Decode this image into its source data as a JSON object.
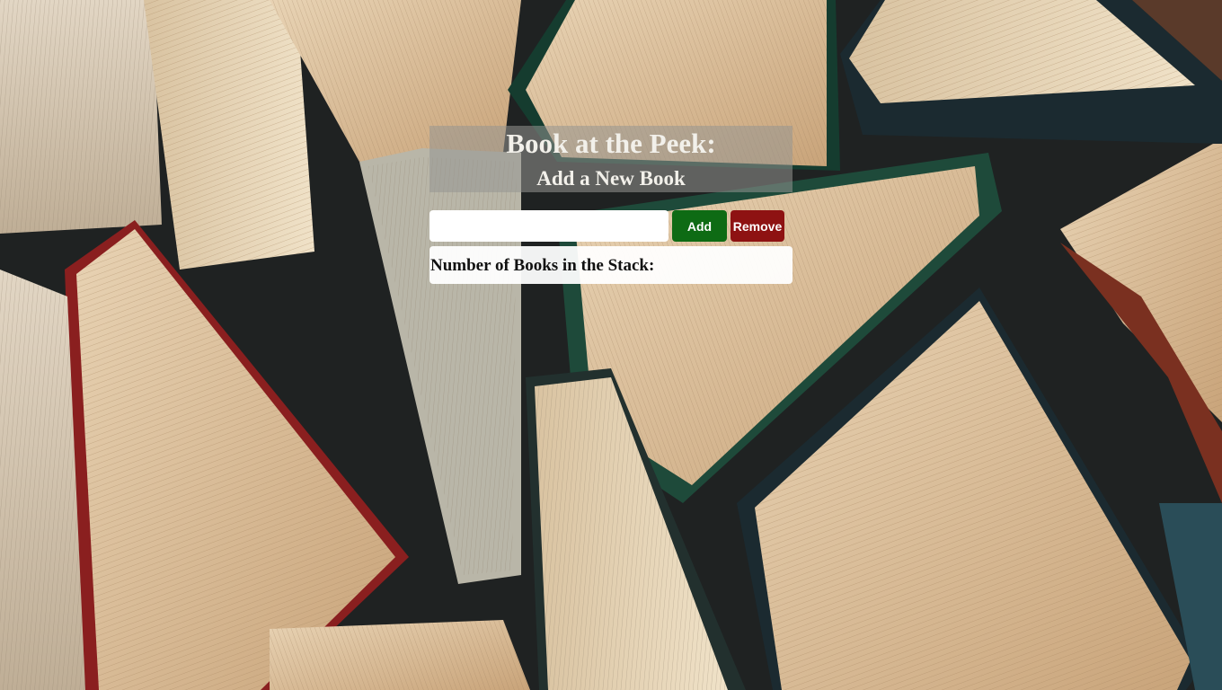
{
  "app": {
    "title": "Book at the Peek:",
    "subtitle": "Add a New Book"
  },
  "form": {
    "input_value": "",
    "input_placeholder": "",
    "add_label": "Add",
    "remove_label": "Remove"
  },
  "stack": {
    "count_label": "Number of Books in the Stack:",
    "count_value": ""
  },
  "colors": {
    "add_button": "#0e6b14",
    "remove_button": "#8e1212"
  }
}
